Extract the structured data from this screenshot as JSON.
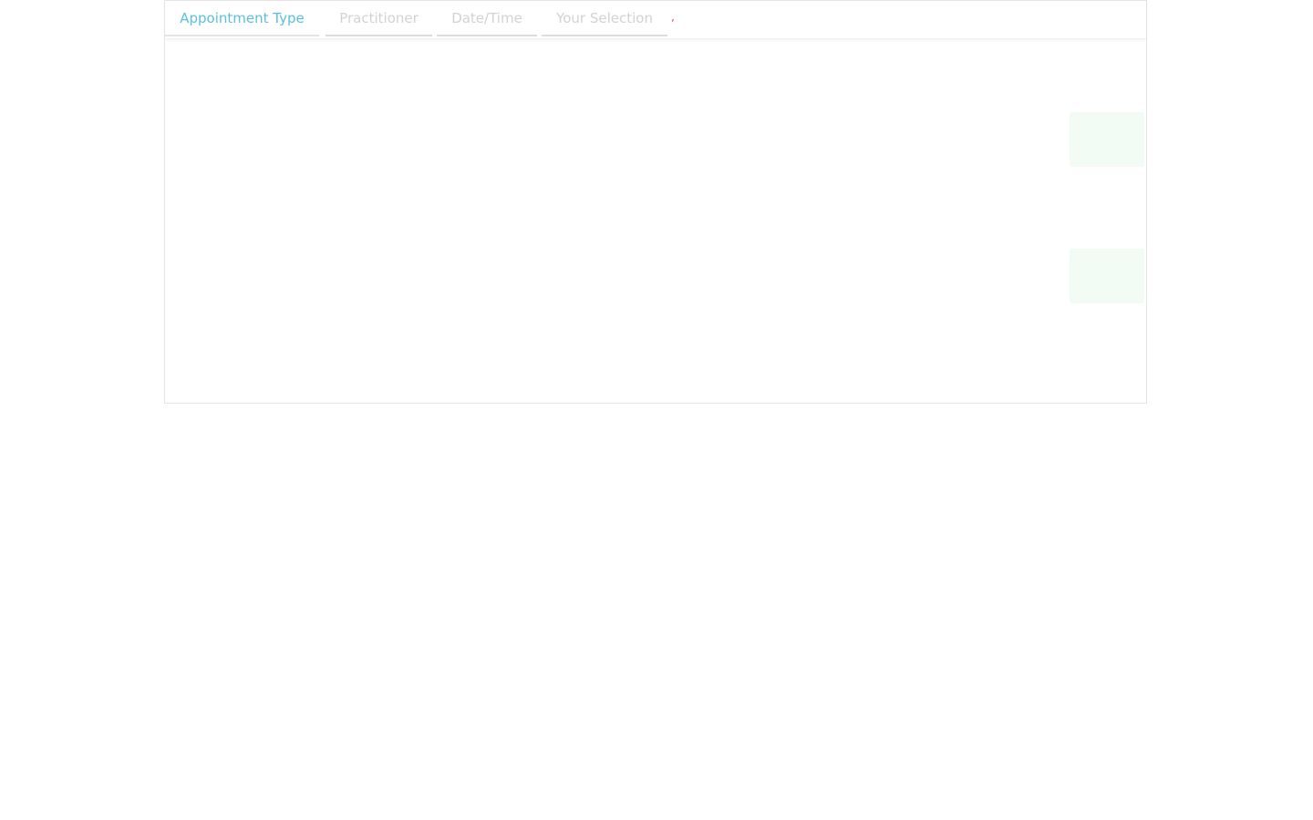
{
  "tabs": [
    {
      "label": "Appointment Type",
      "active": true
    },
    {
      "label": "Practitioner",
      "active": false
    },
    {
      "label": "Date/Time",
      "active": false
    },
    {
      "label": "Your Selection",
      "active": false
    }
  ],
  "loading_mark": "’",
  "panel": {
    "title": "",
    "appointment_types": [
      {
        "name": "",
        "duration": "",
        "description": "",
        "select_label": ""
      },
      {
        "name": "",
        "duration": "",
        "description": "",
        "select_label": ""
      }
    ],
    "back_label": ""
  },
  "colors": {
    "active_tab": "#5bc0de",
    "inactive_tab": "#d2d2d2",
    "loading_mark": "#e6434b",
    "select_button": "#f2fbf4"
  }
}
